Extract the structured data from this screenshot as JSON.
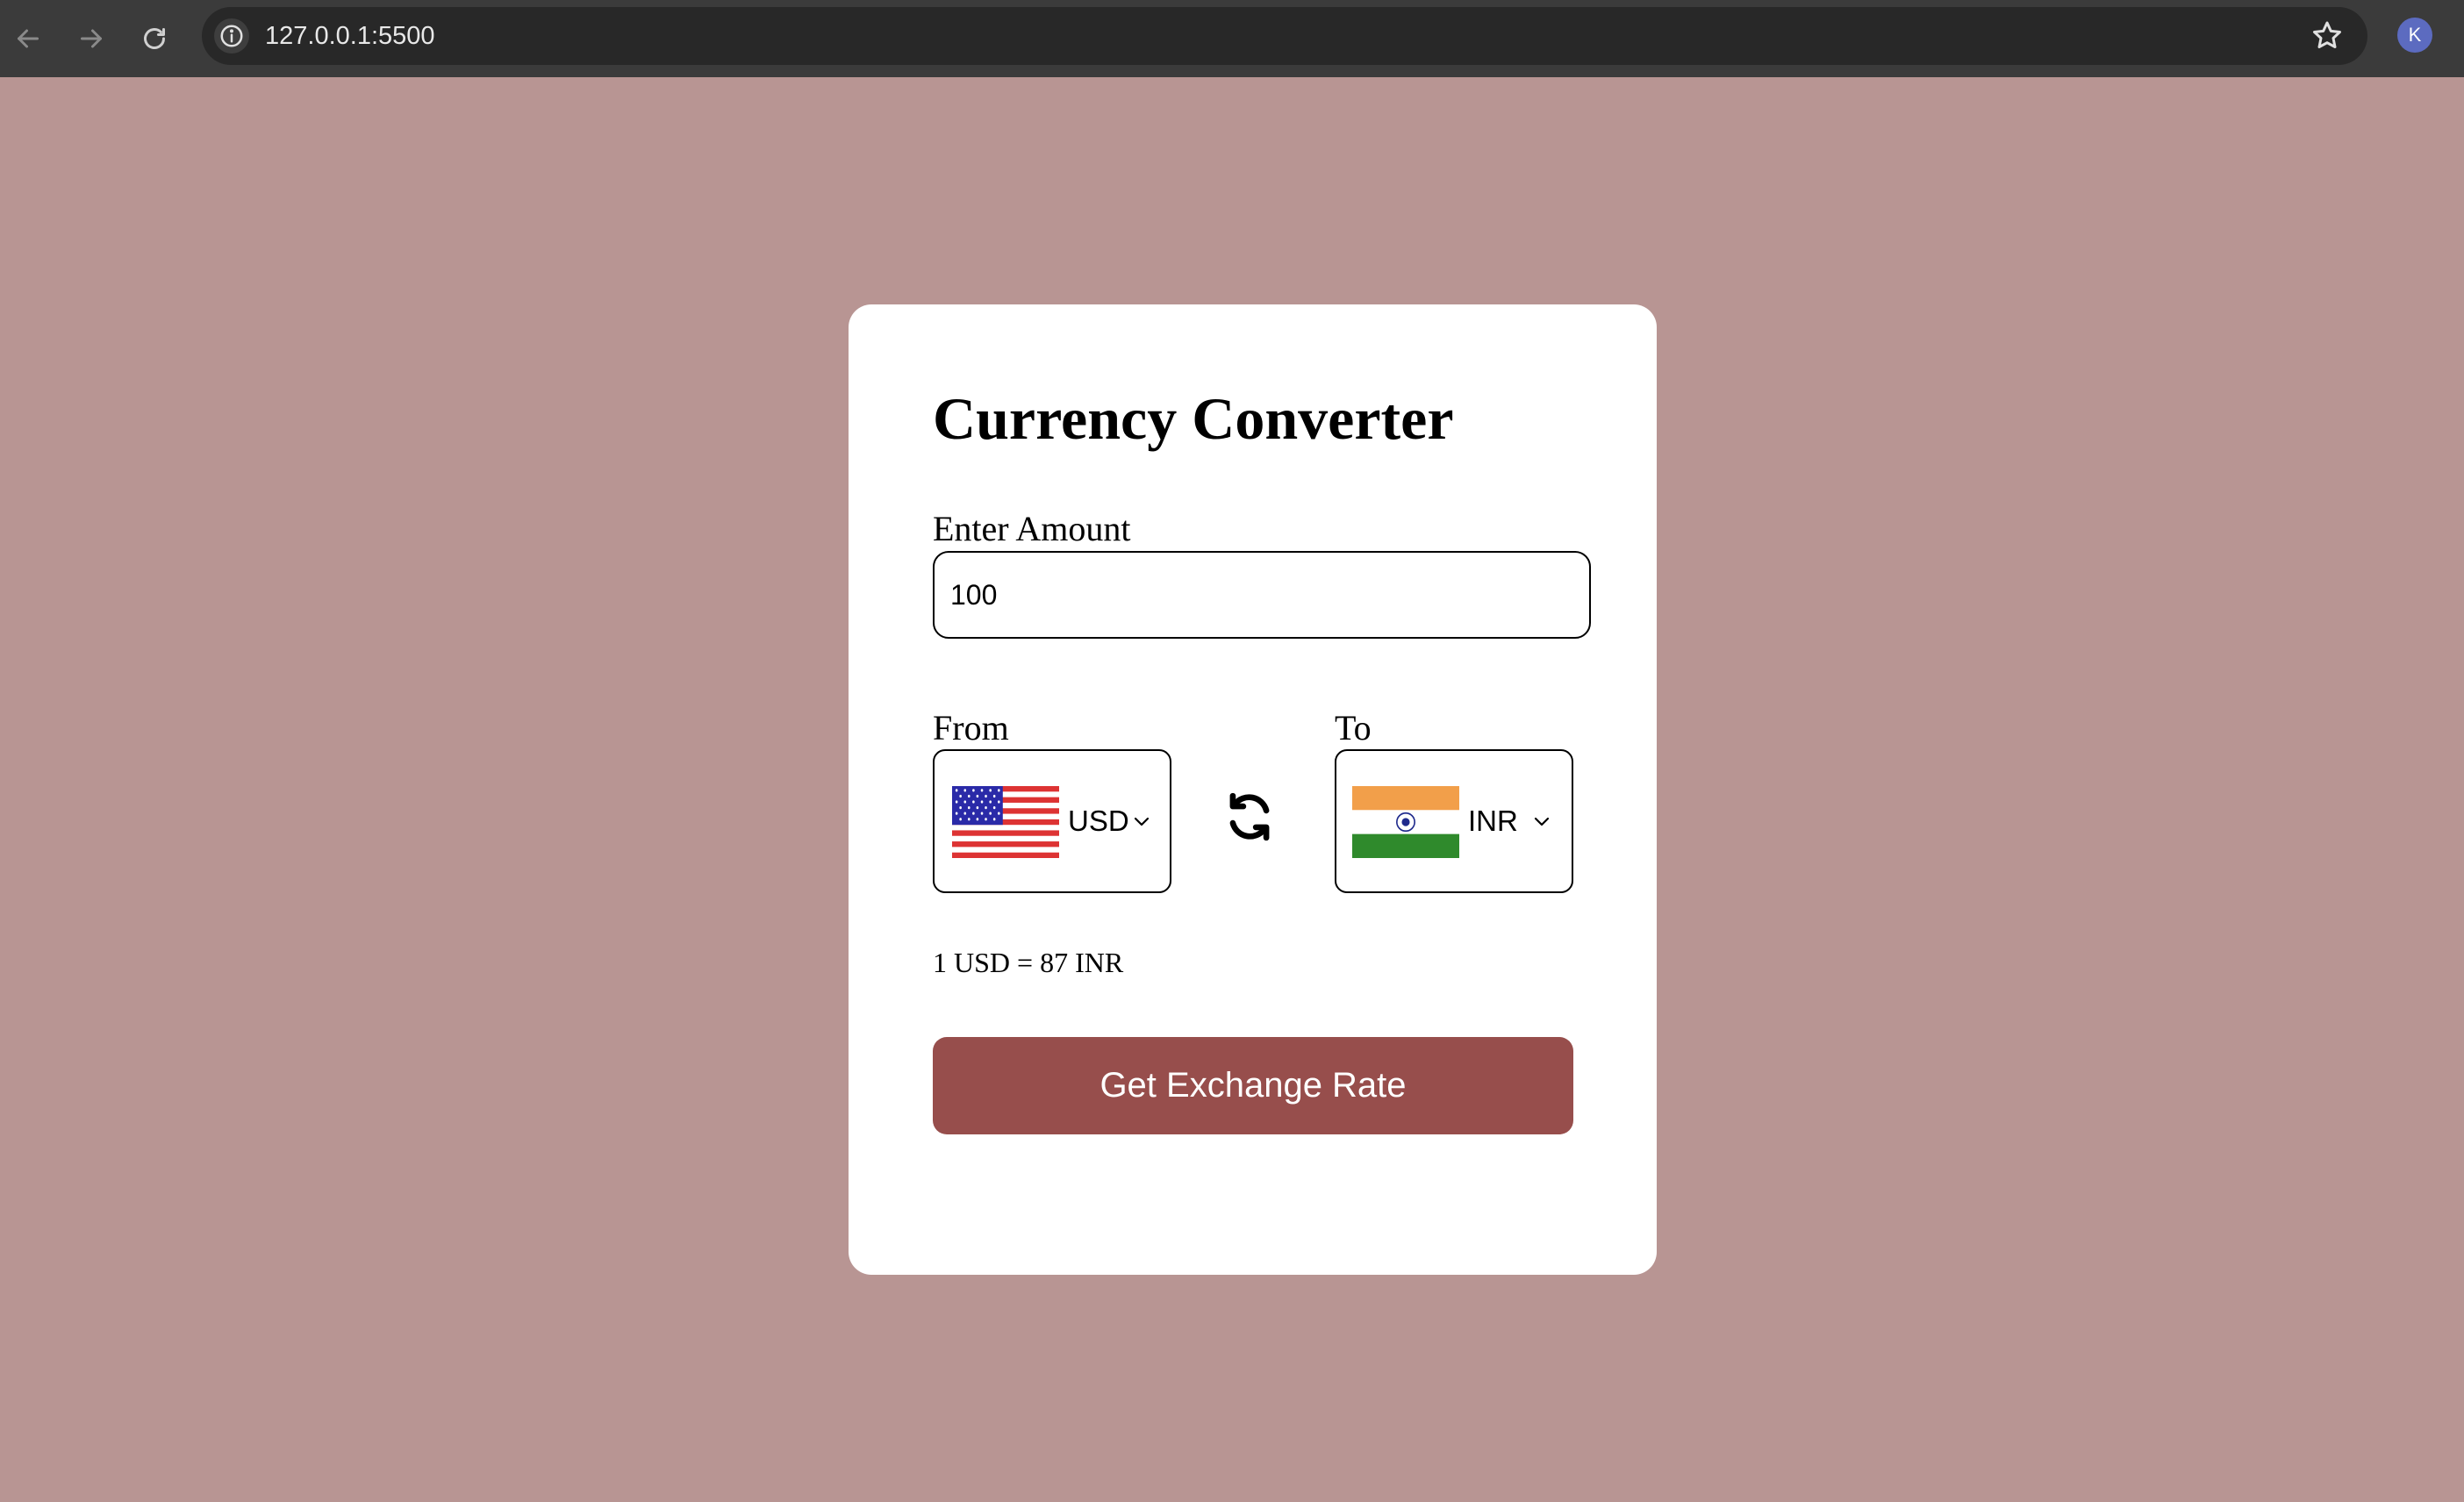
{
  "browser": {
    "url": "127.0.0.1:5500",
    "profile_initial": "K"
  },
  "converter": {
    "title": "Currency Converter",
    "amount_label": "Enter Amount",
    "amount_value": "100",
    "from_label": "From",
    "to_label": "To",
    "from_currency": "USD",
    "to_currency": "INR",
    "rate_text": "1 USD = 87 INR",
    "button_label": "Get Exchange Rate"
  },
  "colors": {
    "page_background": "#b89593",
    "card_background": "#ffffff",
    "button_background": "#974e4c",
    "button_text": "#ffffff"
  },
  "icons": {
    "back": "arrow-left-icon",
    "forward": "arrow-right-icon",
    "reload": "reload-icon",
    "site_info": "info-icon",
    "bookmark": "star-icon",
    "swap": "swap-arrows-icon",
    "dropdown": "chevron-down-icon"
  }
}
